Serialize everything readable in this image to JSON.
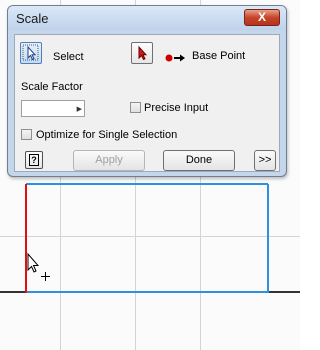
{
  "dialog": {
    "title": "Scale",
    "close_label": "X",
    "select_label": "Select",
    "base_point_label": "Base Point",
    "scale_factor_label": "Scale Factor",
    "scale_factor_value": "",
    "precise_input_label": "Precise Input",
    "precise_input_checked": false,
    "optimize_label": "Optimize for Single Selection",
    "optimize_checked": false,
    "help_label": "?",
    "apply_label": "Apply",
    "done_label": "Done",
    "more_label": ">>"
  },
  "colors": {
    "selection_edge": "#dd1111",
    "rectangle_edge": "#2f8fe0",
    "grid_line": "#d4d4d4",
    "axis_line": "#333333"
  },
  "icons": [
    "select-arrow-icon",
    "base-point-arrow-icon",
    "base-point-dot-icon",
    "help-icon",
    "cursor-arrow-icon",
    "crosshair-icon"
  ]
}
